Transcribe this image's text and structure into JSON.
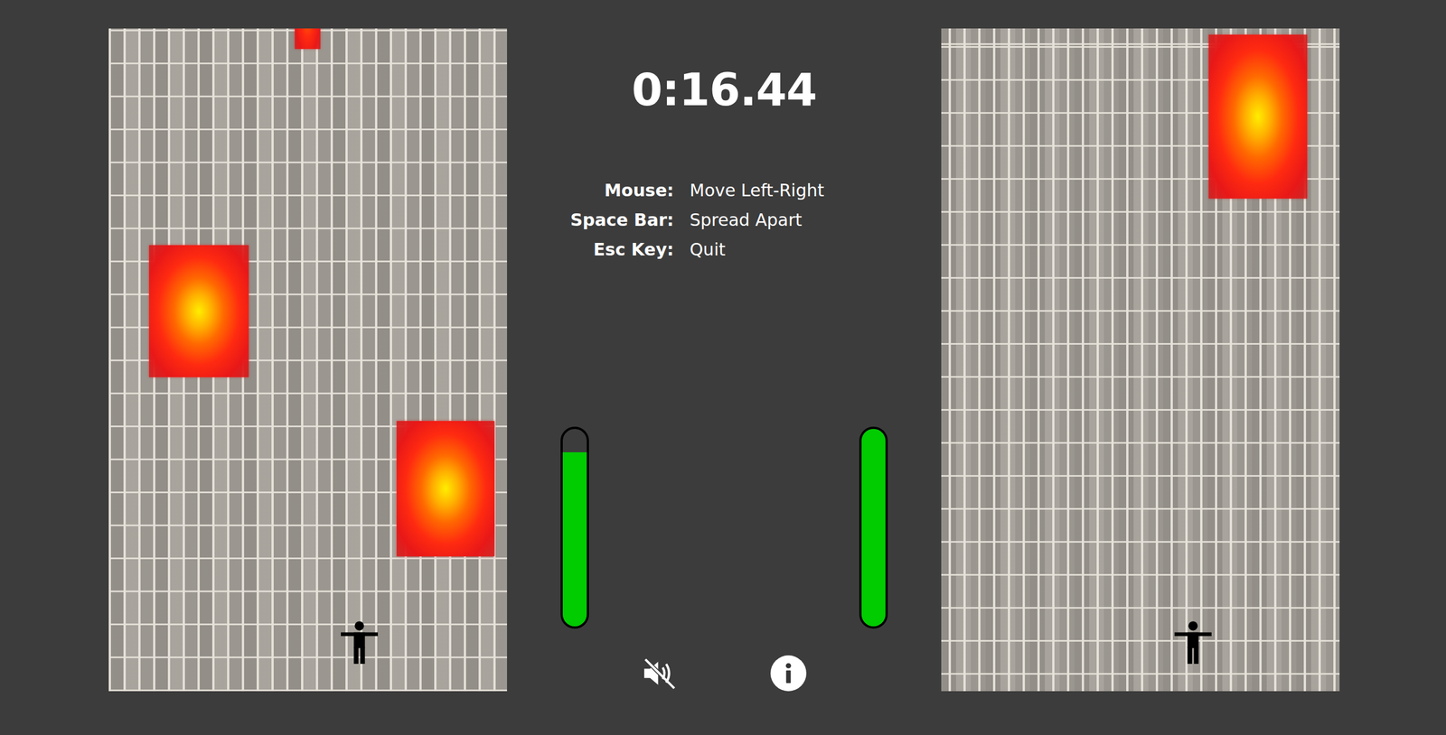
{
  "timer": "0:16.44",
  "controls": [
    {
      "key": "Mouse:",
      "action": "Move Left-Right"
    },
    {
      "key": "Space Bar:",
      "action": "Spread Apart"
    },
    {
      "key": "Esc Key:",
      "action": "Quit"
    }
  ],
  "lanes": [
    {
      "meter": {
        "level": 0.88
      },
      "hazards": [
        {
          "kind": "fire"
        },
        {
          "kind": "fire"
        },
        {
          "kind": "fire"
        }
      ]
    },
    {
      "meter": {
        "level": 1
      },
      "hazards": [
        {
          "kind": "fire"
        }
      ]
    }
  ],
  "sound": {
    "muted": true
  }
}
